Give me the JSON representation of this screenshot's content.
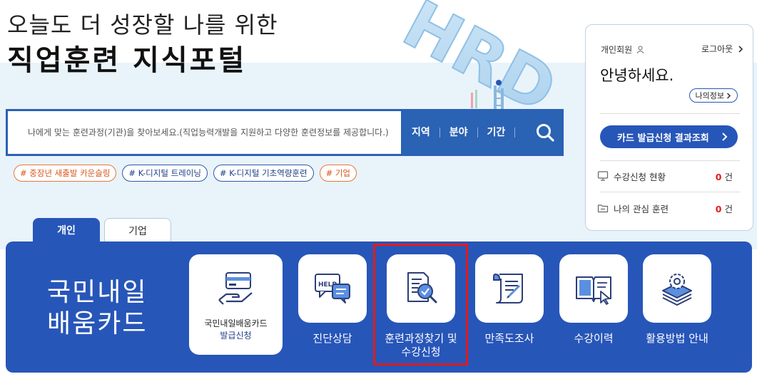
{
  "hero": {
    "line1": "오늘도 더 성장할 나를 위한",
    "line2": "직업훈련 지식포털",
    "decor_text": "HRD"
  },
  "search": {
    "placeholder": "나에게 맞는 훈련과정(기관)을 찾아보세요.(직업능력개발을 지원하고 다양한 훈련정보를 제공합니다.)",
    "menu": [
      "지역",
      "분야",
      "기간"
    ],
    "button_icon": "search-icon"
  },
  "tags": [
    {
      "label": "# 중장년 새출발 카운슬링",
      "color": "#e4753e"
    },
    {
      "label": "# K-디지털 트레이닝",
      "color": "#2c59a8"
    },
    {
      "label": "# K-디지털 기초역량훈련",
      "color": "#2c59a8"
    },
    {
      "label": "# 기업",
      "color": "#e4753e"
    }
  ],
  "tabs": {
    "active": "개인",
    "inactive": "기업"
  },
  "panel": {
    "title_line1": "국민내일",
    "title_line2": "배움카드",
    "card_line1": "국민내일배움카드",
    "card_line2": "발급신청",
    "services": [
      {
        "label_line1": "진단상담",
        "label_line2": "",
        "icon": "help-chat-icon"
      },
      {
        "label_line1": "훈련과정찾기 및",
        "label_line2": "수강신청",
        "icon": "document-search-icon"
      },
      {
        "label_line1": "만족도조사",
        "label_line2": "",
        "icon": "survey-scroll-icon"
      },
      {
        "label_line1": "수강이력",
        "label_line2": "",
        "icon": "open-book-icon"
      },
      {
        "label_line1": "활용방법 안내",
        "label_line2": "",
        "icon": "gear-stack-icon"
      }
    ],
    "accent": "#2756b9",
    "highlight_color": "#e21b1b"
  },
  "user": {
    "member_type": "개인회원",
    "logout": "로그아웃",
    "greeting": "안녕하세요.",
    "my_info": "나의정보",
    "card_result": "카드 발급신청 결과조회",
    "rows": [
      {
        "label": "수강신청 현황",
        "count": "0",
        "unit": "건",
        "icon": "monitor-icon"
      },
      {
        "label": "나의 관심 훈련",
        "count": "0",
        "unit": "건",
        "icon": "folder-icon"
      }
    ]
  }
}
